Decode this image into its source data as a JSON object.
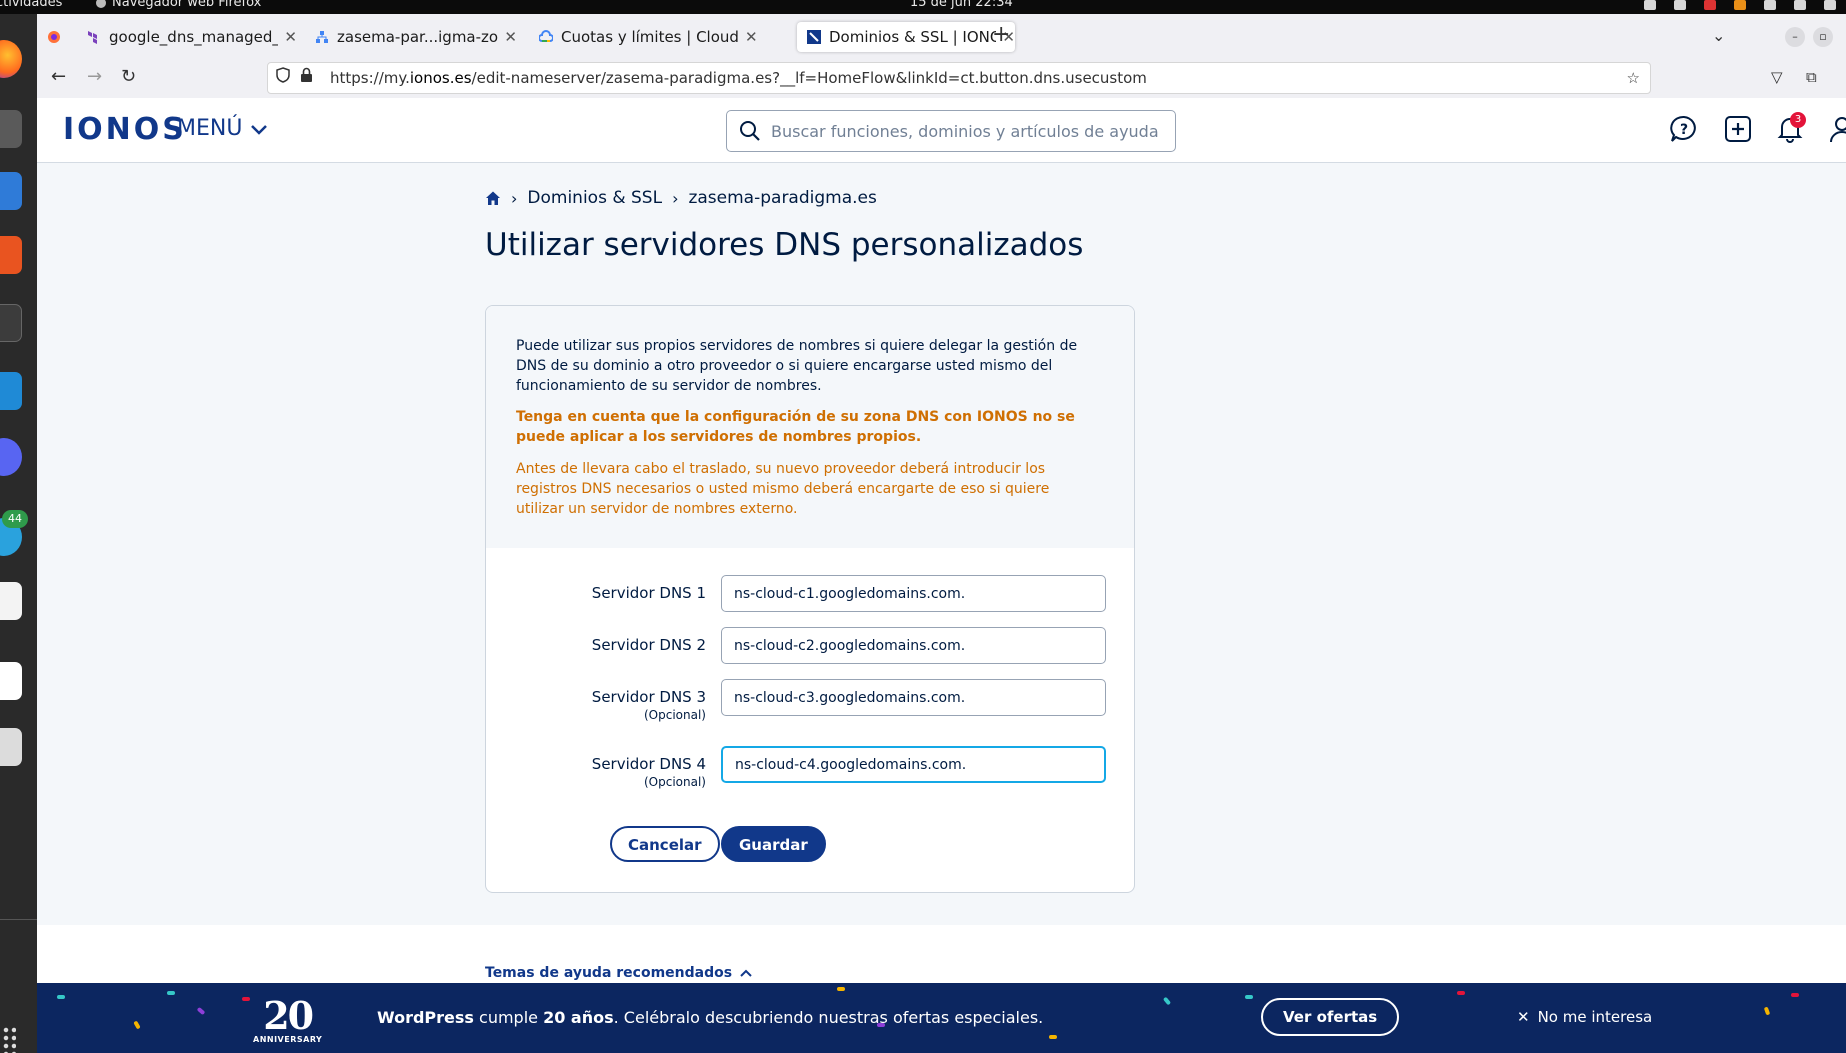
{
  "system_bar": {
    "activities": "ctividades",
    "app_name": "Navegador web Firefox",
    "clock": "15 de jun 22:34"
  },
  "dock": {
    "telegram_badge": "44"
  },
  "browser": {
    "tabs": [
      {
        "title": "google_dns_managed_zo",
        "icon": "terraform-icon"
      },
      {
        "title": "zasema-par...igma-zona",
        "icon": "network-icon"
      },
      {
        "title": "Cuotas y límites | Cloud",
        "icon": "google-cloud-icon"
      },
      {
        "title": "Dominios & SSL | IONOS",
        "icon": "ionos-icon"
      }
    ],
    "active_tab_index": 3,
    "url_prefix": "https://my.",
    "url_domain": "ionos.es",
    "url_suffix": "/edit-nameserver/zasema-paradigma.es?__lf=HomeFlow&linkId=ct.button.dns.usecustom"
  },
  "header": {
    "logo": "IONOS",
    "menu_label": "MENÚ",
    "search_placeholder": "Buscar funciones, dominios y artículos de ayuda",
    "notification_count": "3"
  },
  "breadcrumb": {
    "items": [
      "Dominios & SSL",
      "zasema-paradigma.es"
    ]
  },
  "page": {
    "title": "Utilizar servidores DNS personalizados",
    "intro": "Puede utilizar sus propios servidores de nombres si quiere delegar la gestión de DNS de su dominio a otro proveedor o si quiere encargarse usted mismo del funcionamiento de su servidor de nombres.",
    "warning": "Tenga en cuenta que la configuración de su zona DNS con IONOS no se puede aplicar a los servidores de nombres propios.",
    "note": "Antes de llevara cabo el traslado, su nuevo proveedor deberá introducir los registros DNS necesarios o usted mismo deberá encargarte de eso si quiere utilizar un servidor de nombres externo."
  },
  "dns_servers": [
    {
      "label": "Servidor DNS 1",
      "optional": "",
      "value": "ns-cloud-c1.googledomains.com."
    },
    {
      "label": "Servidor DNS 2",
      "optional": "",
      "value": "ns-cloud-c2.googledomains.com."
    },
    {
      "label": "Servidor DNS 3",
      "optional": "(Opcional)",
      "value": "ns-cloud-c3.googledomains.com."
    },
    {
      "label": "Servidor DNS 4",
      "optional": "(Opcional)",
      "value": "ns-cloud-c4.googledomains.com."
    }
  ],
  "actions": {
    "cancel": "Cancelar",
    "save": "Guardar"
  },
  "help": {
    "label": "Temas de ayuda recomendados"
  },
  "promo": {
    "badge_number": "20",
    "badge_text": "ANNIVERSARY",
    "text_brand": "WordPress",
    "text_mid": " cumple ",
    "text_years": "20 años",
    "text_rest": ". Celébralo descubriendo nuestras ofertas especiales.",
    "cta": "Ver ofertas",
    "dismiss": "No me interesa"
  },
  "colors": {
    "brand_blue": "#11388a",
    "navy": "#001b41",
    "warning_orange": "#cf6f02",
    "focus_blue": "#14a8e6",
    "banner_bg": "#0c2660"
  }
}
